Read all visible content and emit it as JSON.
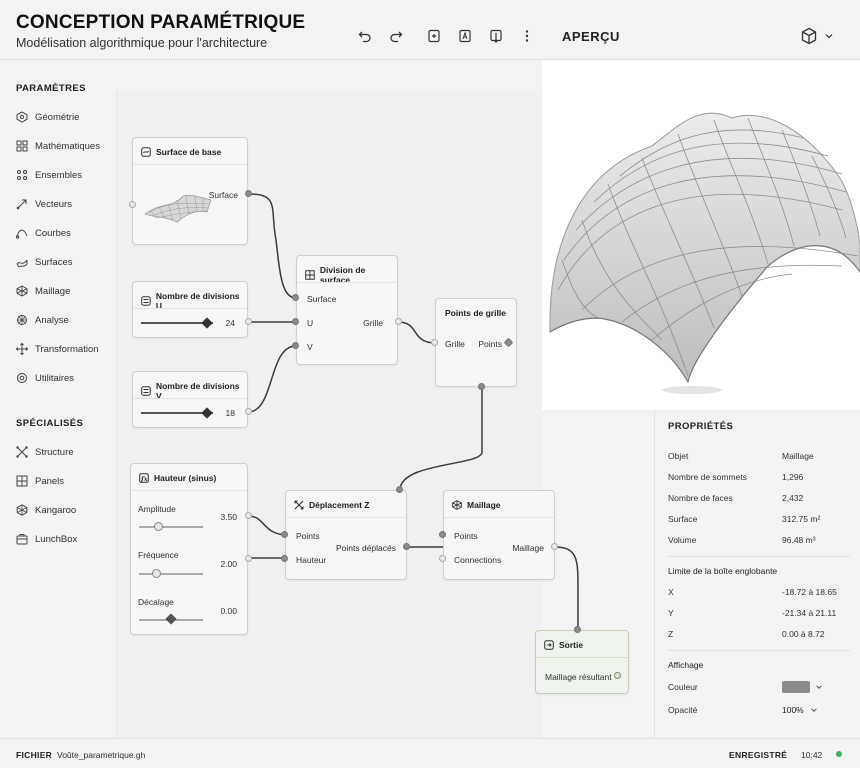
{
  "header": {
    "title": "CONCEPTION PARAMÉTRIQUE",
    "subtitle": "Modélisation algorithmique pour l'architecture",
    "toolbar_icons": [
      "undo-icon",
      "redo-icon",
      "add-node-icon",
      "text-node-icon",
      "export-icon",
      "more-icon"
    ],
    "preview_label": "APERÇU",
    "view_icon": "cube-icon"
  },
  "sidebar": {
    "parameters_heading": "PARAMÈTRES",
    "parameters": [
      {
        "label": "Géométrie",
        "icon": "geometry-icon"
      },
      {
        "label": "Mathématiques",
        "icon": "math-icon"
      },
      {
        "label": "Ensembles",
        "icon": "sets-icon"
      },
      {
        "label": "Vecteurs",
        "icon": "vector-icon"
      },
      {
        "label": "Courbes",
        "icon": "curve-icon"
      },
      {
        "label": "Surfaces",
        "icon": "surface-icon"
      },
      {
        "label": "Maillage",
        "icon": "mesh-icon"
      },
      {
        "label": "Analyse",
        "icon": "analysis-icon"
      },
      {
        "label": "Transformation",
        "icon": "transform-icon"
      },
      {
        "label": "Utilitaires",
        "icon": "utilities-icon"
      }
    ],
    "specialized_heading": "SPÉCIALISÉS",
    "specialized": [
      {
        "label": "Structure",
        "icon": "structure-icon"
      },
      {
        "label": "Panels",
        "icon": "panels-icon"
      },
      {
        "label": "Kangaroo",
        "icon": "kangaroo-icon"
      },
      {
        "label": "LunchBox",
        "icon": "lunchbox-icon"
      }
    ]
  },
  "nodes": {
    "base_surface": {
      "title": "Surface de base",
      "output": "Surface"
    },
    "divisions_u": {
      "title": "Nombre de divisions U",
      "value": "24",
      "level": 0.92
    },
    "divisions_v": {
      "title": "Nombre de divisions V",
      "value": "18",
      "level": 0.92
    },
    "surface_division": {
      "title": "Division de surface",
      "inputs": [
        "Surface",
        "U",
        "V"
      ],
      "output": "Grille"
    },
    "grid_points": {
      "title": "Points de grille",
      "input": "Grille",
      "output": "Points"
    },
    "height": {
      "title": "Hauteur (sinus)",
      "params": [
        {
          "label": "Amplitude",
          "value": "3.50",
          "level": 0.3
        },
        {
          "label": "Fréquence",
          "value": "2.00",
          "level": 0.27
        },
        {
          "label": "Décalage",
          "value": "0.00",
          "level": 0.5
        }
      ]
    },
    "z_displacement": {
      "title": "Déplacement Z",
      "inputs": [
        "Points",
        "Hauteur"
      ],
      "output": "Points déplacés"
    },
    "mesh": {
      "title": "Maillage",
      "inputs": [
        "Points",
        "Connections"
      ],
      "output": "Maillage"
    },
    "output": {
      "title": "Sortie",
      "input": "Maillage résultant"
    }
  },
  "properties": {
    "title": "PROPRIÉTÉS",
    "rows": [
      {
        "key": "Objet",
        "value": "Maillage"
      },
      {
        "key": "Nombre de sommets",
        "value": "1,296"
      },
      {
        "key": "Nombre de faces",
        "value": "2,432"
      },
      {
        "key": "Surface",
        "value": "312.75 m²"
      },
      {
        "key": "Volume",
        "value": "96.48 m³"
      }
    ],
    "bbox_heading": "Limite de la boîte englobante",
    "bbox": [
      {
        "key": "X",
        "value": "-18.72 à 18.65"
      },
      {
        "key": "Y",
        "value": "-21.34 à 21.11"
      },
      {
        "key": "Z",
        "value": "0.00 à 8.72"
      }
    ],
    "display_heading": "Affichage",
    "color_label": "Couleur",
    "color_value": "#8a8a8a",
    "opacity_label": "Opacité",
    "opacity_value": "100%"
  },
  "statusbar": {
    "file_label": "FICHIER",
    "file_name": "Voûte_parametrique.gh",
    "saved_label": "ENREGISTRÉ",
    "time": "10:42",
    "status_color": "#3fb35a"
  }
}
